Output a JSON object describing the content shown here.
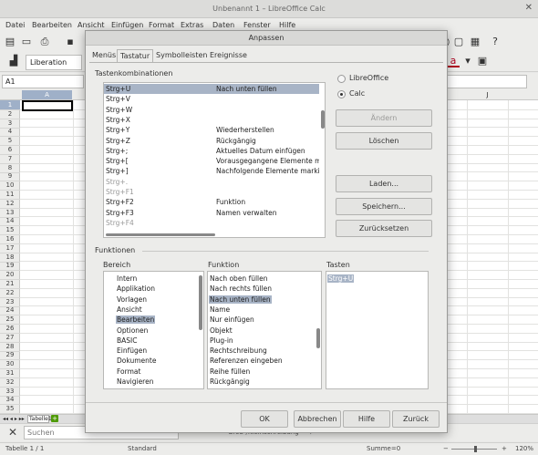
{
  "window": {
    "title": "Unbenannt 1 – LibreOffice Calc",
    "close_glyph": "✕"
  },
  "menubar": [
    "Datei",
    "Bearbeiten",
    "Ansicht",
    "Einfügen",
    "Format",
    "Extras",
    "Daten",
    "Fenster",
    "Hilfe"
  ],
  "toolbar": {
    "font_name": "Liberation Sans"
  },
  "formula_bar": {
    "cell_ref": "A1"
  },
  "columns": [
    "A",
    "J"
  ],
  "rows": [
    "1",
    "2",
    "3",
    "4",
    "5",
    "6",
    "7",
    "8",
    "9",
    "10",
    "11",
    "12",
    "13",
    "14",
    "15",
    "16",
    "17",
    "18",
    "19",
    "20",
    "21",
    "22",
    "23",
    "24",
    "25",
    "26",
    "27",
    "28",
    "29",
    "30",
    "31",
    "32",
    "33",
    "34",
    "35"
  ],
  "sheet_tab": "Tabelle1",
  "find": {
    "placeholder": "Suchen",
    "partial_label": "Groß-/Kleinschreibung"
  },
  "status": {
    "sheet": "Tabelle 1 / 1",
    "style": "Standard",
    "sum": "Summe=0",
    "zoom": "120%"
  },
  "dialog": {
    "title": "Anpassen",
    "tabs": [
      "Menüs",
      "Tastatur",
      "Symbolleisten",
      "Ereignisse"
    ],
    "active_tab": "Tastatur",
    "shortcuts_heading": "Tastenkombinationen",
    "shortcuts": [
      {
        "key": "Strg+U",
        "fn": "Nach unten füllen",
        "selected": true
      },
      {
        "key": "Strg+V",
        "fn": ""
      },
      {
        "key": "Strg+W",
        "fn": ""
      },
      {
        "key": "Strg+X",
        "fn": ""
      },
      {
        "key": "Strg+Y",
        "fn": "Wiederherstellen"
      },
      {
        "key": "Strg+Z",
        "fn": "Rückgängig"
      },
      {
        "key": "Strg+;",
        "fn": "Aktuelles Datum einfügen"
      },
      {
        "key": "Strg+[",
        "fn": "Vorausgegangene Elemente mar"
      },
      {
        "key": "Strg+]",
        "fn": "Nachfolgende Elemente markiere"
      },
      {
        "key": "Strg+.",
        "fn": "",
        "dim": true
      },
      {
        "key": "Strg+F1",
        "fn": "",
        "dim": true
      },
      {
        "key": "Strg+F2",
        "fn": "Funktion"
      },
      {
        "key": "Strg+F3",
        "fn": "Namen verwalten"
      },
      {
        "key": "Strg+F4",
        "fn": "",
        "dim": true
      }
    ],
    "scope_options": [
      "LibreOffice",
      "Calc"
    ],
    "scope_selected": "Calc",
    "buttons": {
      "change": "Ändern",
      "delete": "Löschen",
      "load": "Laden...",
      "save": "Speichern...",
      "reset": "Zurücksetzen"
    },
    "functions_heading": "Funktionen",
    "category_label": "Bereich",
    "function_label": "Funktion",
    "keys_label": "Tasten",
    "categories": [
      {
        "label": "Intern"
      },
      {
        "label": "Applikation"
      },
      {
        "label": "Vorlagen"
      },
      {
        "label": "Ansicht"
      },
      {
        "label": "Bearbeiten",
        "selected": true
      },
      {
        "label": "Optionen"
      },
      {
        "label": "BASIC"
      },
      {
        "label": "Einfügen"
      },
      {
        "label": "Dokumente"
      },
      {
        "label": "Format"
      },
      {
        "label": "Navigieren"
      }
    ],
    "functions": [
      {
        "label": "Nach oben füllen"
      },
      {
        "label": "Nach rechts füllen"
      },
      {
        "label": "Nach unten füllen",
        "selected": true
      },
      {
        "label": "Name"
      },
      {
        "label": "Nur einfügen"
      },
      {
        "label": "Objekt"
      },
      {
        "label": "Plug-in"
      },
      {
        "label": "Rechtschreibung"
      },
      {
        "label": "Referenzen eingeben"
      },
      {
        "label": "Reihe füllen"
      },
      {
        "label": "Rückgängig"
      }
    ],
    "keys": [
      "Strg+U"
    ],
    "footer": {
      "ok": "OK",
      "cancel": "Abbrechen",
      "help": "Hilfe",
      "back": "Zurück"
    }
  }
}
